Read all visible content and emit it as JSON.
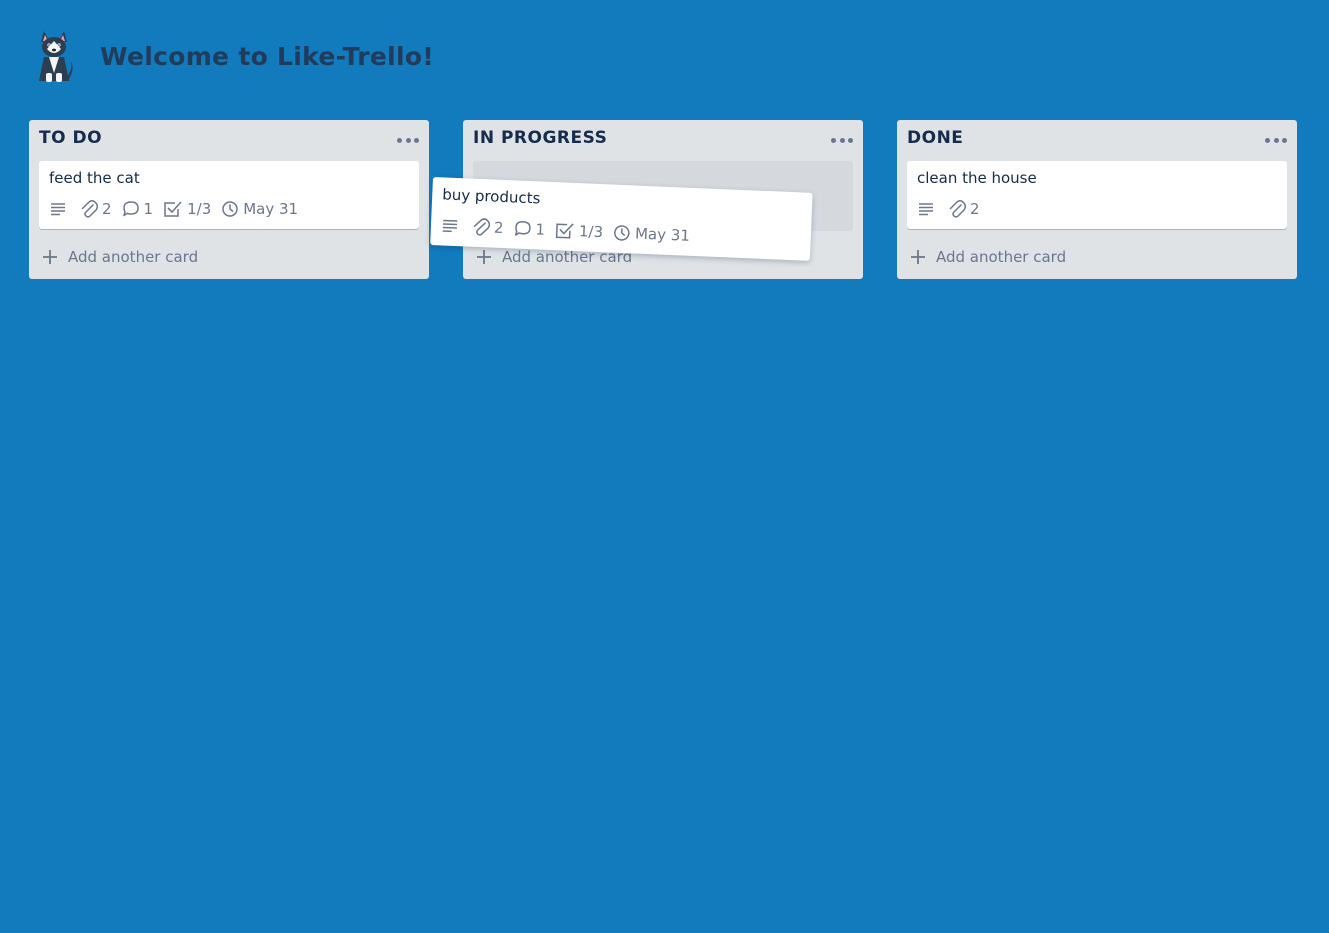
{
  "header": {
    "title": "Welcome to Like-Trello!",
    "logo_icon": "husky-dog-logo"
  },
  "colors": {
    "background": "#117bbd",
    "list": "#dfe3e6",
    "card": "#ffffff",
    "title_text": "#213b5a",
    "muted": "#6b778c"
  },
  "lists": [
    {
      "title": "TO DO",
      "add_label": "Add another card",
      "cards": [
        {
          "title": "feed the cat",
          "attachments": "2",
          "comments": "1",
          "checklist": "1/3",
          "due": "May 31"
        }
      ]
    },
    {
      "title": "IN PROGRESS",
      "add_label": "Add another card",
      "cards": []
    },
    {
      "title": "DONE",
      "add_label": "Add another card",
      "cards": [
        {
          "title": "clean the house",
          "attachments": "2"
        }
      ]
    }
  ],
  "dragging_card": {
    "title": "buy products",
    "attachments": "2",
    "comments": "1",
    "checklist": "1/3",
    "due": "May 31"
  }
}
